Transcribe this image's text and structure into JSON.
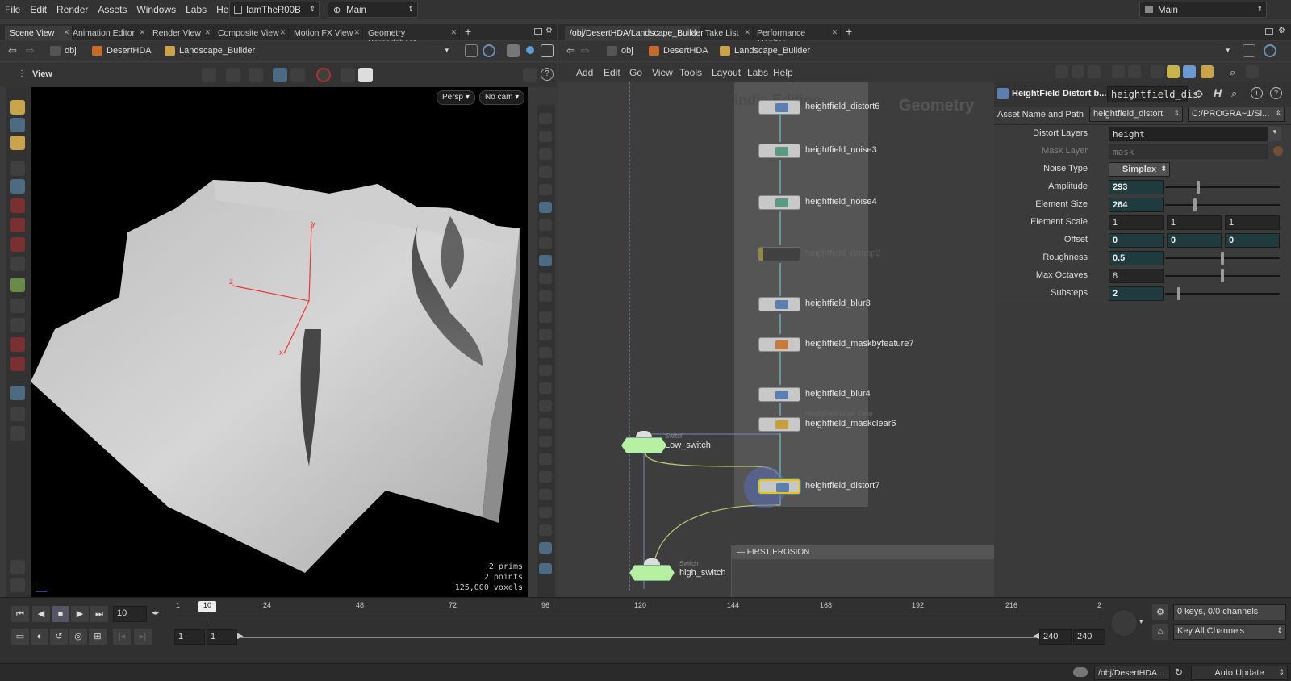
{
  "menu": {
    "items": [
      "File",
      "Edit",
      "Render",
      "Assets",
      "Windows",
      "Labs",
      "Help"
    ],
    "desktop": "IamTheR00B",
    "context": "Main",
    "right_context": "Main"
  },
  "left_panel": {
    "tabs": [
      "Scene View",
      "Animation Editor",
      "Render View",
      "Composite View",
      "Motion FX View",
      "Geometry Spreadsheet"
    ],
    "path": [
      "obj",
      "DesertHDA",
      "Landscape_Builder"
    ],
    "view_label": "View",
    "persp": "Persp ▾",
    "cam": "No cam ▾",
    "axes": {
      "y": "y",
      "z": "z",
      "x": "x"
    },
    "stats": {
      "prims": "2  prims",
      "points": "2 points",
      "voxels": "125,000 voxels"
    }
  },
  "right_panel": {
    "tabs": [
      "/obj/DesertHDA/Landscape_Builder",
      "Take List",
      "Performance Monitor"
    ],
    "path": [
      "obj",
      "DesertHDA",
      "Landscape_Builder"
    ],
    "net_menu": [
      "Add",
      "Edit",
      "Go",
      "View",
      "Tools",
      "Layout",
      "Labs",
      "Help"
    ],
    "watermark_left": "Indie Edition",
    "watermark_right": "Geometry",
    "nodes": [
      {
        "label": "heightfield_distort6"
      },
      {
        "label": "heightfield_noise3"
      },
      {
        "label": "heightfield_noise4"
      },
      {
        "label": "heightfield_remap2"
      },
      {
        "label": "heightfield_blur3"
      },
      {
        "label": "heightfield_maskbyfeature7"
      },
      {
        "label": "heightfield_blur4"
      },
      {
        "label": "heightfield_maskclear6",
        "sublabel": "HeightField Layer Clear"
      },
      {
        "label": "heightfield_distort7"
      }
    ],
    "switches": [
      {
        "type": "Switch",
        "label": "Low_switch"
      },
      {
        "type": "Switch",
        "label": "high_switch"
      }
    ],
    "netbox_title": "FIRST EROSION"
  },
  "params": {
    "header_title": "HeightField Distort b...",
    "header_name": "heightfield_dis",
    "asset_label": "Asset Name and Path",
    "asset_name": "heightfield_distort",
    "asset_path": "C:/PROGRA~1/Si...",
    "rows": [
      {
        "label": "Distort Layers",
        "value": "height"
      },
      {
        "label": "Mask Layer",
        "value": "mask"
      },
      {
        "label": "Noise Type",
        "value": "Simplex"
      },
      {
        "label": "Amplitude",
        "value": "293",
        "slider": 0.29
      },
      {
        "label": "Element Size",
        "value": "264",
        "slider": 0.26
      },
      {
        "label": "Element Scale",
        "values": [
          "1",
          "1",
          "1"
        ]
      },
      {
        "label": "Offset",
        "values": [
          "0",
          "0",
          "0"
        ]
      },
      {
        "label": "Roughness",
        "value": "0.5",
        "slider": 0.5
      },
      {
        "label": "Max Octaves",
        "value": "8",
        "slider": 0.5
      },
      {
        "label": "Substeps",
        "value": "2",
        "slider": 0.12
      }
    ]
  },
  "timeline": {
    "current_frame": "10",
    "frame_marker": "10",
    "ticks": [
      "1",
      "24",
      "48",
      "72",
      "96",
      "120",
      "144",
      "168",
      "192",
      "216",
      "2"
    ],
    "range_start": "1",
    "range_start2": "1",
    "range_end": "240",
    "range_end2": "240",
    "keys": "0 keys, 0/0 channels",
    "key_all": "Key All Channels",
    "status_path": "/obj/DesertHDA...",
    "auto_update": "Auto Update"
  }
}
